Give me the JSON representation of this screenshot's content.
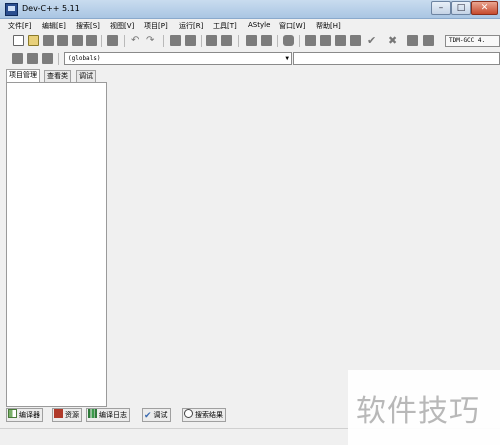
{
  "window": {
    "title": "Dev-C++ 5.11"
  },
  "menu": {
    "items": [
      {
        "label": "文件[F]"
      },
      {
        "label": "编辑[E]"
      },
      {
        "label": "搜索[S]"
      },
      {
        "label": "视图[V]"
      },
      {
        "label": "项目[P]"
      },
      {
        "label": "运行[R]"
      },
      {
        "label": "工具[T]"
      },
      {
        "label": "AStyle"
      },
      {
        "label": "窗口[W]"
      },
      {
        "label": "帮助[H]"
      }
    ]
  },
  "toolbar": {
    "compiler": "TDM-GCC 4."
  },
  "toolbar2": {
    "globals": "(globals)"
  },
  "left_tabs": [
    {
      "label": "项目管理"
    },
    {
      "label": "查看类"
    },
    {
      "label": "调试"
    }
  ],
  "bottom_tabs": [
    {
      "label": "编译器"
    },
    {
      "label": "资源"
    },
    {
      "label": "编译日志"
    },
    {
      "label": "调试"
    },
    {
      "label": "搜索结果"
    }
  ],
  "watermark": {
    "text": "软件技巧"
  }
}
